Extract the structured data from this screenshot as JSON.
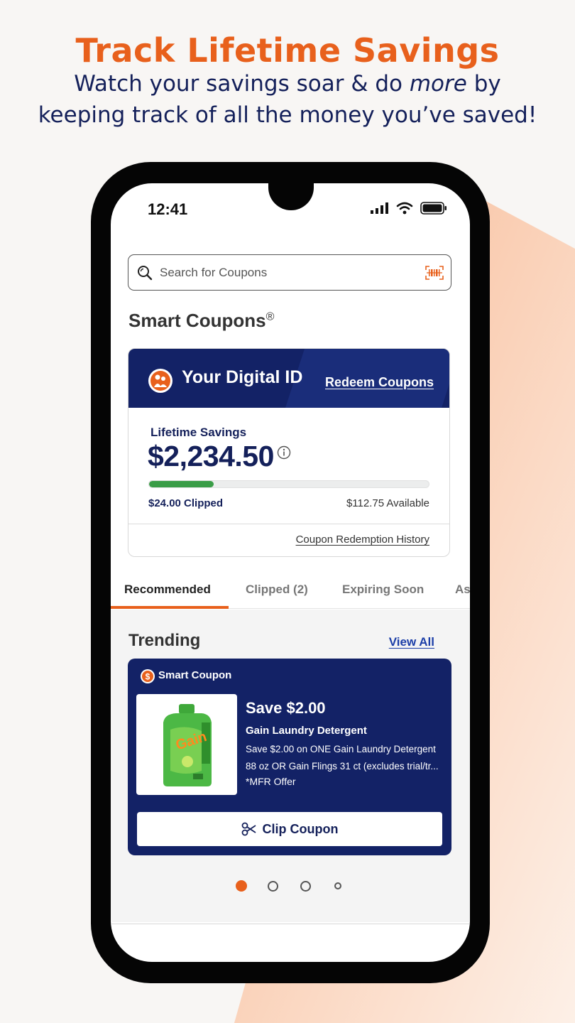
{
  "promo": {
    "headline": "Track Lifetime Savings",
    "subline_part1": "Watch your savings soar & do ",
    "subline_emphasis": "more",
    "subline_part2": " by keeping track of all the money you’ve saved!"
  },
  "status_bar": {
    "time": "12:41"
  },
  "search": {
    "placeholder": "Search for Coupons"
  },
  "smart_coupons": {
    "title": "Smart Coupons",
    "trademark": "®"
  },
  "digital_id": {
    "title": "Your Digital ID",
    "redeem_label": "Redeem Coupons",
    "lifetime_label": "Lifetime Savings",
    "lifetime_amount": "$2,234.50",
    "clipped_text": "$24.00 Clipped",
    "available_text": "$112.75 Available",
    "clipped_fraction": 0.23,
    "history_link": "Coupon Redemption History"
  },
  "tabs": [
    {
      "label": "Recommended",
      "active": true
    },
    {
      "label": "Clipped (2)",
      "active": false
    },
    {
      "label": "Expiring Soon",
      "active": false
    },
    {
      "label": "As",
      "active": false
    }
  ],
  "trending": {
    "title": "Trending",
    "view_all": "View All"
  },
  "coupon": {
    "badge": "Smart Coupon",
    "save_title": "Save $2.00",
    "product_name": "Gain Laundry Detergent",
    "description": "Save $2.00 on ONE Gain Laundry Detergent 88 oz OR Gain Flings 31 ct (excludes trial/tr...",
    "offer_type": "*MFR Offer",
    "clip_label": "Clip Coupon",
    "product_brand_text": "Gain"
  },
  "carousel": {
    "count": 4,
    "active_index": 0
  },
  "colors": {
    "accent": "#e8601c",
    "navy": "#132266",
    "progress": "#3a9d47",
    "link": "#1b3ea8"
  }
}
